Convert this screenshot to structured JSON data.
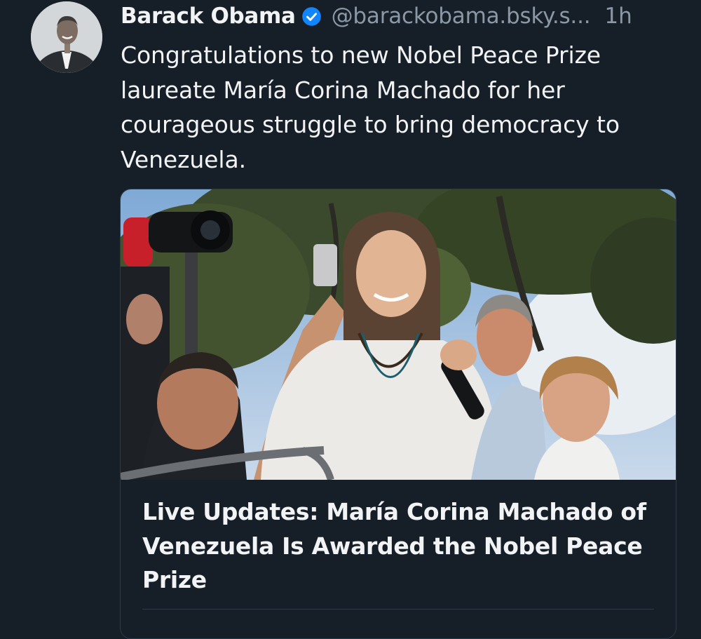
{
  "post": {
    "author": {
      "display_name": "Barack Obama",
      "handle": "@barackobama.bsky.s...",
      "verified": true,
      "avatar_icon": "avatar-portrait"
    },
    "time_ago": "1h",
    "text": "Congratulations to new Nobel Peace Prize laureate María Corina Machado for her courageous struggle to bring democracy to Venezuela.",
    "embed": {
      "image_icon": "news-photo-crowd",
      "title": "Live Updates: María Corina Machado of Venezuela Is Awarded the Nobel Peace Prize"
    }
  },
  "colors": {
    "background": "#161e27",
    "text_primary": "#f1f3f5",
    "text_secondary": "#8b98a5",
    "verified_badge": "#1185fe",
    "border": "#2e3a47"
  }
}
